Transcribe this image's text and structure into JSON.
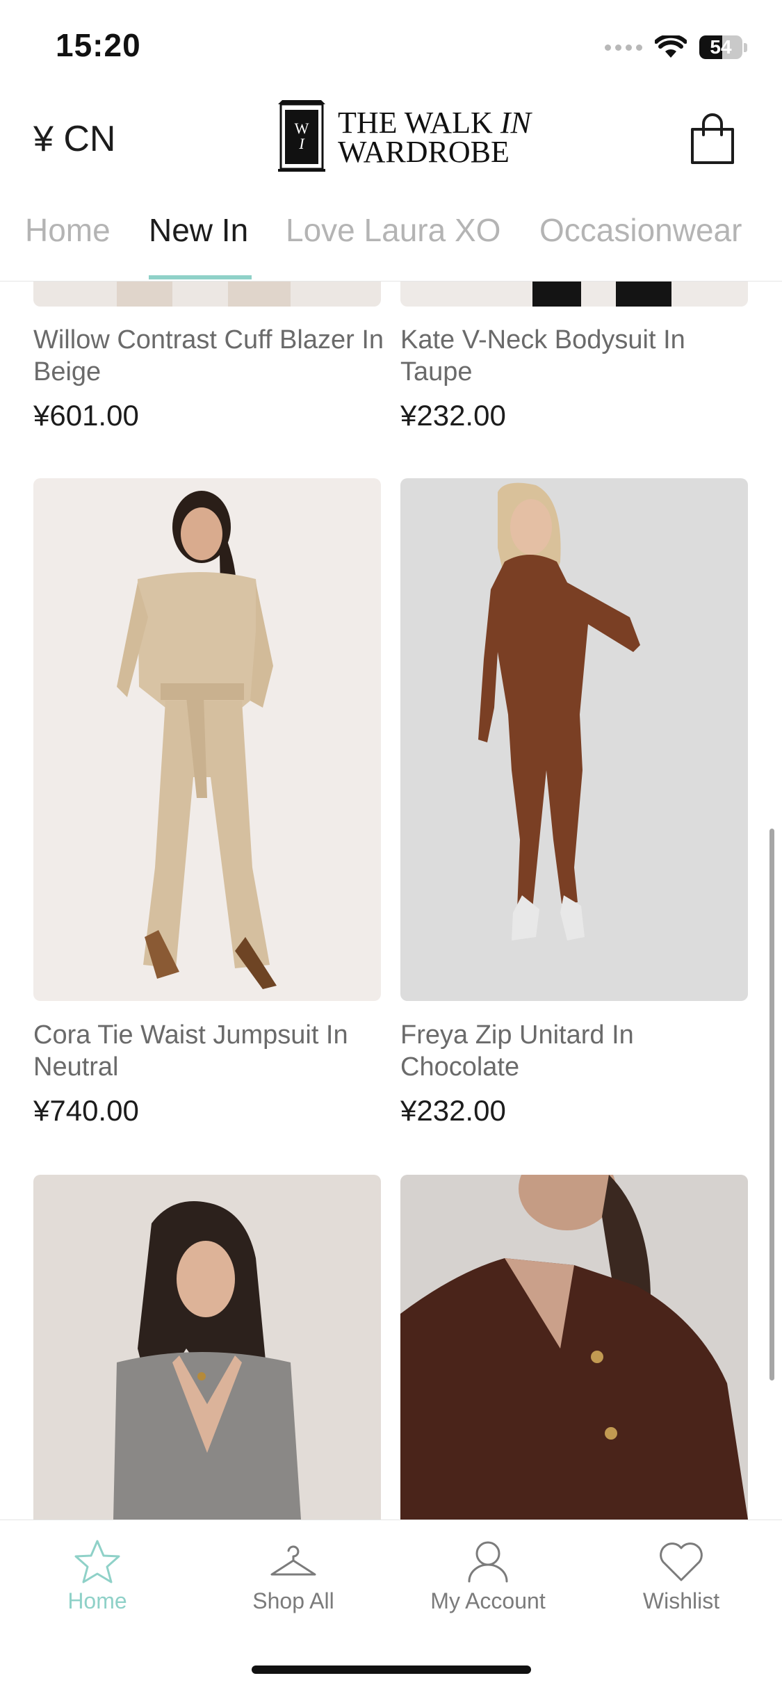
{
  "status_bar": {
    "time": "15:20",
    "battery": "54"
  },
  "header": {
    "currency": "¥ CN",
    "logo_mark": "WIW",
    "logo_line1": "THE WALK ",
    "logo_line1_italic": "IN",
    "logo_line2": "WARDROBE",
    "bag_icon": "shopping-bag-icon"
  },
  "tabs": [
    {
      "label": "Home",
      "active": false
    },
    {
      "label": "New In",
      "active": true
    },
    {
      "label": "Love Laura XO",
      "active": false
    },
    {
      "label": "Occasionwear",
      "active": false
    }
  ],
  "products": [
    {
      "name": "Willow Contrast Cuff Blazer In Beige",
      "price": "¥601.00",
      "image_bg": "#ece7e3"
    },
    {
      "name": "Kate V-Neck Bodysuit In Taupe",
      "price": "¥232.00",
      "image_bg": "#eeeae7"
    },
    {
      "name": "Cora Tie Waist Jumpsuit In Neutral",
      "price": "¥740.00",
      "image_bg": "#f1ece9"
    },
    {
      "name": "Freya Zip Unitard In Chocolate",
      "price": "¥232.00",
      "image_bg": "#dcdcdc"
    },
    {
      "name": "",
      "price": "",
      "image_bg": "#e2dcd7"
    },
    {
      "name": "",
      "price": "",
      "image_bg": "#d6d2cf"
    }
  ],
  "bottom_nav": [
    {
      "label": "Home",
      "icon": "star-icon",
      "active": true
    },
    {
      "label": "Shop All",
      "icon": "hanger-icon",
      "active": false
    },
    {
      "label": "My Account",
      "icon": "person-icon",
      "active": false
    },
    {
      "label": "Wishlist",
      "icon": "heart-icon",
      "active": false
    }
  ],
  "colors": {
    "accent": "#8fd1c8",
    "text": "#1c1c1c",
    "muted": "#b4b4b4"
  }
}
